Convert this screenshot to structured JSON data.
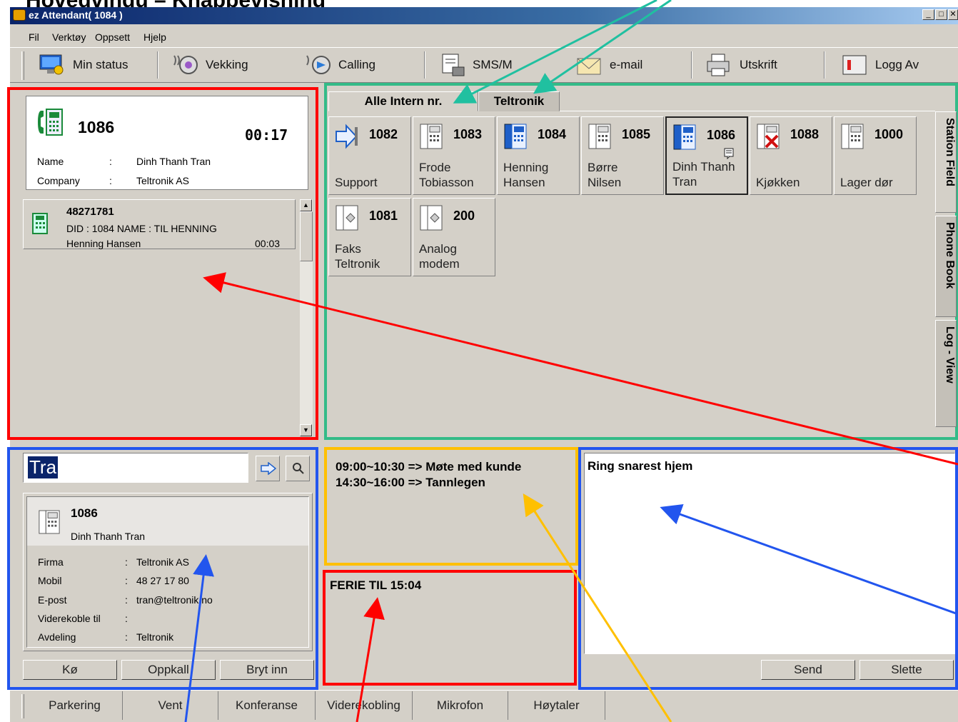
{
  "slide_title": "Hovedvindu – Knappevisning",
  "window": {
    "title": "ez Attendant( 1084 )",
    "minimize": "_",
    "maximize": "□",
    "close": "✕"
  },
  "menu": [
    "Fil",
    "Verktøy",
    "Oppsett",
    "Hjelp"
  ],
  "toolbar": [
    {
      "label": "Min status",
      "icon": "status-monitor-icon"
    },
    {
      "label": "Vekking",
      "icon": "wake-up-icon"
    },
    {
      "label": "Calling",
      "icon": "calling-icon"
    },
    {
      "label": "SMS/M",
      "icon": "sms-icon"
    },
    {
      "label": "e-mail",
      "icon": "email-icon"
    },
    {
      "label": "Utskrift",
      "icon": "printer-icon"
    },
    {
      "label": "Logg Av",
      "icon": "logout-icon"
    }
  ],
  "active_call": {
    "number": "1086",
    "timer": "00:17",
    "name_label": "Name",
    "name": "Dinh Thanh Tran",
    "company_label": "Company",
    "company": "Teltronik AS",
    "sep": ":"
  },
  "queue": [
    {
      "number": "48271781",
      "did": "DID : 1084  NAME : TIL HENNING",
      "caller": "Henning Hansen",
      "time": "00:03"
    }
  ],
  "tabs": [
    "Alle Intern nr.",
    "Teltronik"
  ],
  "side_tabs": [
    "Station Field",
    "Phone Book",
    "Log - View"
  ],
  "stations": [
    {
      "number": "1082",
      "label": "Support",
      "icon": "forward-arrow-icon"
    },
    {
      "number": "1083",
      "label": "Frode\nTobiasson",
      "icon": "phone-idle-icon"
    },
    {
      "number": "1084",
      "label": "Henning\nHansen",
      "icon": "phone-active-icon"
    },
    {
      "number": "1085",
      "label": "Børre\nNilsen",
      "icon": "phone-idle-icon"
    },
    {
      "number": "1086",
      "label": "Dinh Thanh\nTran",
      "icon": "phone-active-icon"
    },
    {
      "number": "1088",
      "label": "Kjøkken",
      "icon": "phone-blocked-icon"
    },
    {
      "number": "1000",
      "label": "Lager dør",
      "icon": "phone-idle-icon"
    },
    {
      "number": "1081",
      "label": "Faks\nTeltronik",
      "icon": "fax-icon"
    },
    {
      "number": "200",
      "label": "Analog\nmodem",
      "icon": "modem-icon"
    }
  ],
  "search": {
    "value": "Tra"
  },
  "contact": {
    "number": "1086",
    "name": "Dinh Thanh Tran",
    "fields": [
      {
        "label": "Firma",
        "value": "Teltronik AS"
      },
      {
        "label": "Mobil",
        "value": "48 27 17 80"
      },
      {
        "label": "E-post",
        "value": "tran@teltronik.no"
      },
      {
        "label": "Viderekoble til",
        "value": ""
      },
      {
        "label": "Avdeling",
        "value": "Teltronik"
      }
    ],
    "sep": ":"
  },
  "contact_buttons": [
    "Kø",
    "Oppkall",
    "Bryt inn"
  ],
  "schedule": {
    "line1": "09:00~10:30 => Møte med kunde",
    "line2": "14:30~16:00 => Tannlegen"
  },
  "absence": "FERIE TIL 15:04",
  "message": {
    "text": "Ring snarest hjem",
    "send": "Send",
    "delete": "Slette"
  },
  "status_bar": [
    "Parkering",
    "Vent",
    "Konferanse",
    "Viderekobling",
    "Mikrofon",
    "Høytaler"
  ],
  "colors": {
    "red": "#ff0000",
    "green": "#33bb88",
    "blue": "#2255ee",
    "yellow": "#ffc000"
  }
}
